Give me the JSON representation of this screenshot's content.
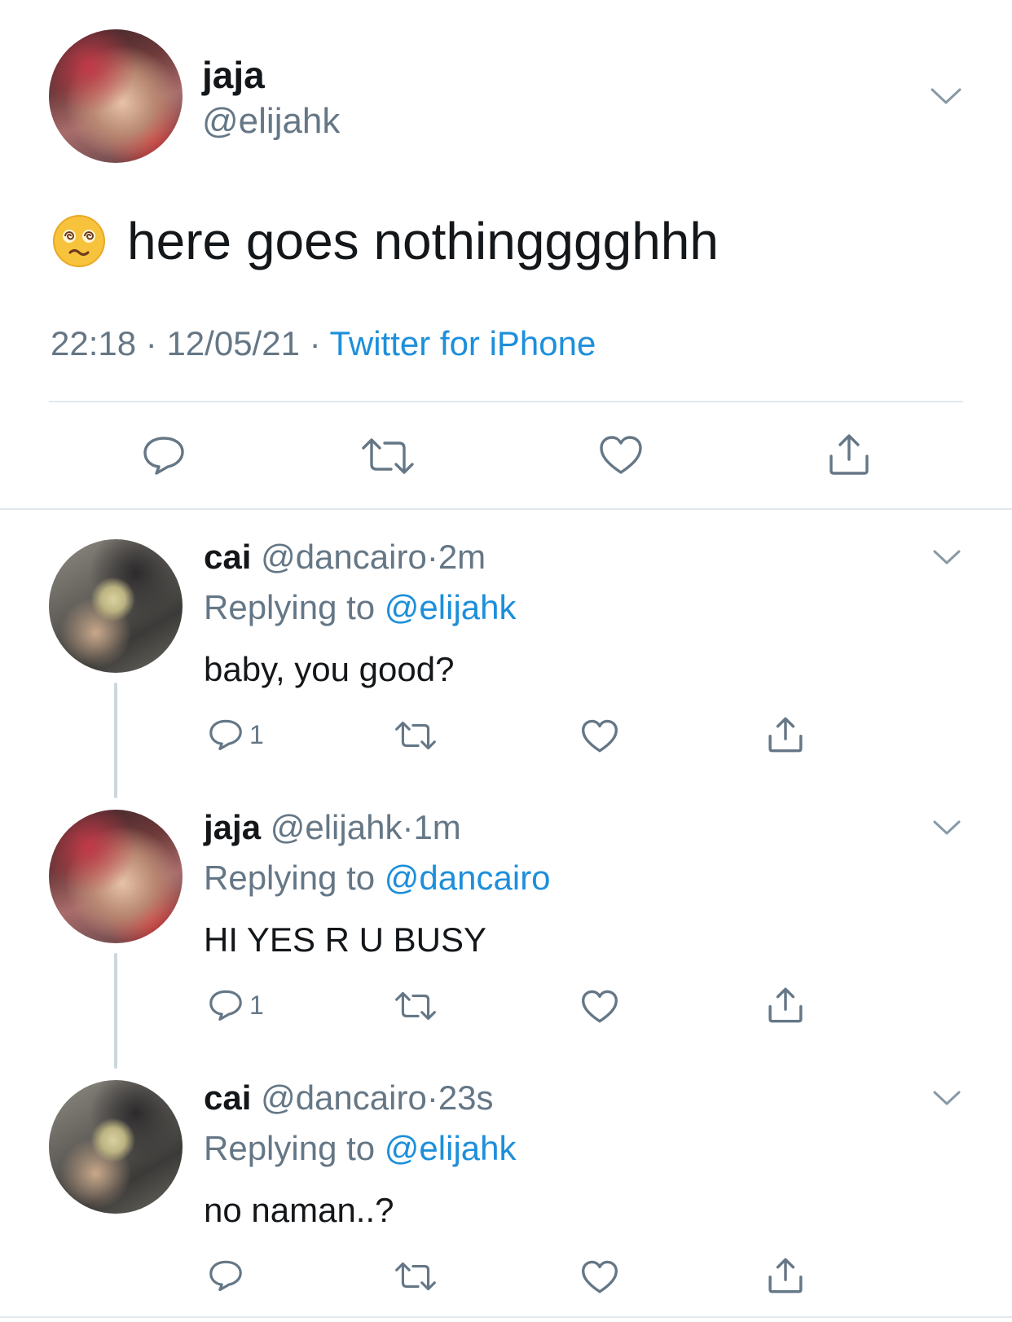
{
  "main_tweet": {
    "display_name": "jaja",
    "handle": "@elijahk",
    "emoji": "😵‍💫",
    "text": "here goes nothingggghhh",
    "time": "22:18",
    "date": "12/05/21",
    "source": "Twitter for iPhone",
    "separator": "·"
  },
  "replies": [
    {
      "display_name": "cai",
      "handle": "@dancairo",
      "time": "2m",
      "replying_label": "Replying to",
      "replying_to": "@elijahk",
      "text": "baby, you good?",
      "reply_count": "1"
    },
    {
      "display_name": "jaja",
      "handle": "@elijahk",
      "time": "1m",
      "replying_label": "Replying to",
      "replying_to": "@dancairo",
      "text": "HI YES R U BUSY",
      "reply_count": "1"
    },
    {
      "display_name": "cai",
      "handle": "@dancairo",
      "time": "23s",
      "replying_label": "Replying to",
      "replying_to": "@elijahk",
      "text": "no naman..?",
      "reply_count": ""
    }
  ],
  "colors": {
    "link": "#1d8fdb",
    "muted": "#657786",
    "divider": "#e1e8ed",
    "thread_line": "#ccd6dd"
  },
  "icons": {
    "reply": "reply-icon",
    "retweet": "retweet-icon",
    "like": "heart-icon",
    "share": "share-icon",
    "menu": "chevron-down-icon"
  }
}
